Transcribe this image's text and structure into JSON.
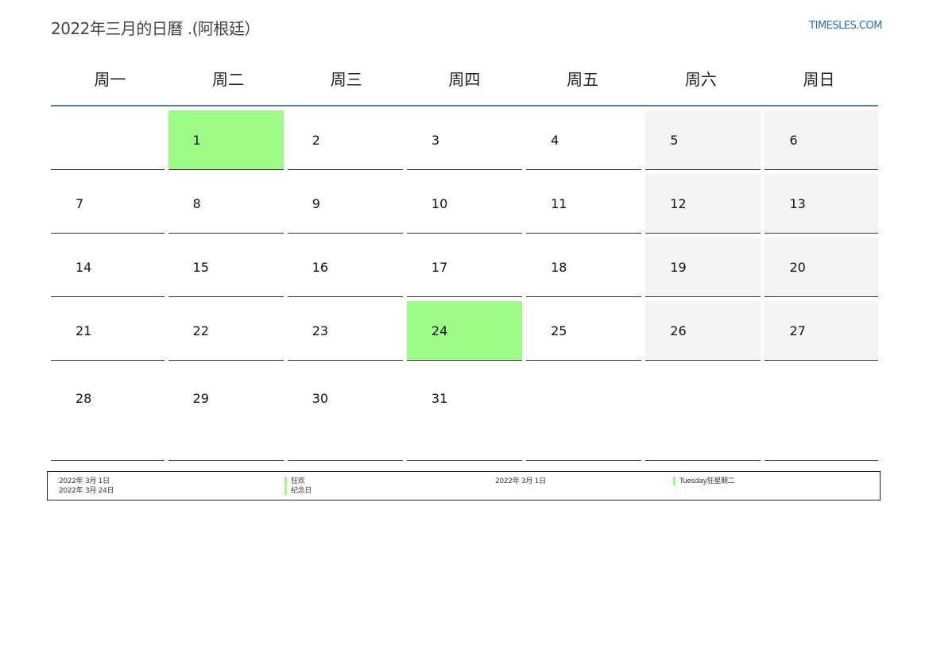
{
  "header": {
    "title": "2022年三月的日曆 .(阿根廷）",
    "site": "TIMESLES.COM"
  },
  "weekdays": [
    "周一",
    "周二",
    "周三",
    "周四",
    "周五",
    "周六",
    "周日"
  ],
  "weeks": [
    [
      {
        "day": ""
      },
      {
        "day": "1",
        "holiday": true
      },
      {
        "day": "2"
      },
      {
        "day": "3"
      },
      {
        "day": "4"
      },
      {
        "day": "5",
        "weekend": true
      },
      {
        "day": "6",
        "weekend": true
      }
    ],
    [
      {
        "day": "7"
      },
      {
        "day": "8"
      },
      {
        "day": "9"
      },
      {
        "day": "10"
      },
      {
        "day": "11"
      },
      {
        "day": "12",
        "weekend": true
      },
      {
        "day": "13",
        "weekend": true
      }
    ],
    [
      {
        "day": "14"
      },
      {
        "day": "15"
      },
      {
        "day": "16"
      },
      {
        "day": "17"
      },
      {
        "day": "18"
      },
      {
        "day": "19",
        "weekend": true
      },
      {
        "day": "20",
        "weekend": true
      }
    ],
    [
      {
        "day": "21"
      },
      {
        "day": "22"
      },
      {
        "day": "23"
      },
      {
        "day": "24",
        "holiday": true
      },
      {
        "day": "25"
      },
      {
        "day": "26",
        "weekend": true
      },
      {
        "day": "27",
        "weekend": true
      }
    ],
    [
      {
        "day": "28"
      },
      {
        "day": "29"
      },
      {
        "day": "30"
      },
      {
        "day": "31"
      },
      {
        "day": ""
      },
      {
        "day": ""
      },
      {
        "day": ""
      }
    ]
  ],
  "colors": {
    "holiday": "#9cfc86",
    "weekend": "#f4f4f4",
    "header_rule": "#5b7a9a",
    "site_link": "#2a6ebb"
  },
  "legend": {
    "col1": [
      "2022年 3月 1日",
      "2022年 3月 24日"
    ],
    "col2": [
      "狂欢",
      "纪念日"
    ],
    "col3": [
      "2022年 3月 1日"
    ],
    "col4": [
      "Tuesday狂星期二"
    ]
  }
}
